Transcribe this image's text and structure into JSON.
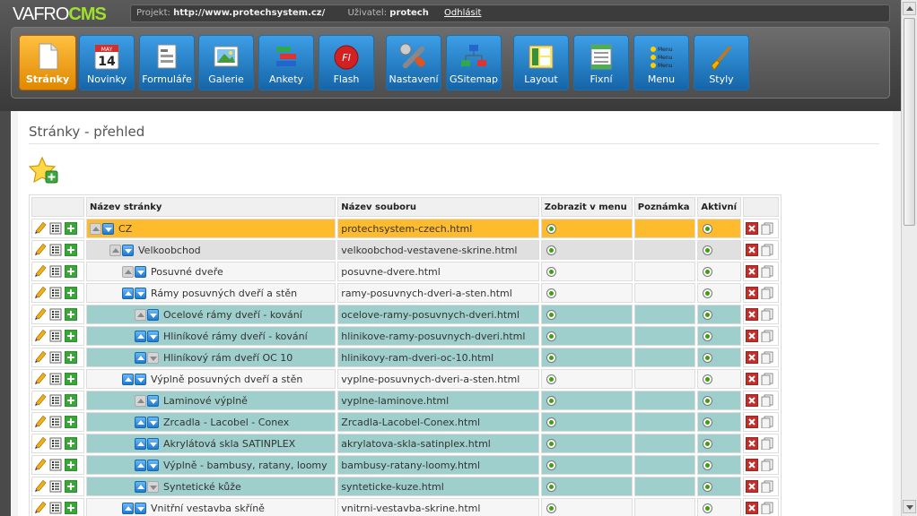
{
  "logo": {
    "part1": "VAFRO",
    "part2": "CMS"
  },
  "infobar": {
    "project_label": "Projekt:",
    "project_value": "http://www.protechsystem.cz/",
    "user_label": "Uživatel:",
    "user_value": "protech",
    "logout": "Odhlásit"
  },
  "toolbar": {
    "items": [
      {
        "label": "Stránky",
        "icon": "page-icon",
        "active": true
      },
      {
        "label": "Novinky",
        "icon": "calendar-icon",
        "calendar_month": "MAY",
        "calendar_day": "14"
      },
      {
        "label": "Formuláře",
        "icon": "form-icon"
      },
      {
        "label": "Galerie",
        "icon": "gallery-icon"
      },
      {
        "label": "Ankety",
        "icon": "poll-icon"
      },
      {
        "label": "Flash",
        "icon": "flash-icon",
        "icon_text": "Fl"
      },
      {
        "label": "Nastavení",
        "icon": "wrench-icon"
      },
      {
        "label": "GSitemap",
        "icon": "sitemap-icon"
      },
      {
        "label": "Layout",
        "icon": "layout-icon"
      },
      {
        "label": "Fixní",
        "icon": "fixed-icon"
      },
      {
        "label": "Menu",
        "icon": "menu-icon",
        "icon_text": "Menu"
      },
      {
        "label": "Styly",
        "icon": "brush-icon"
      }
    ]
  },
  "page": {
    "title": "Stránky - přehled"
  },
  "table": {
    "headers": {
      "name": "Název stránky",
      "file": "Název souboru",
      "show_in_menu": "Zobrazit v menu",
      "note": "Poznámka",
      "active": "Aktivní"
    },
    "rows": [
      {
        "name": "CZ",
        "file": "protechsystem-czech.html",
        "level": 0,
        "up": false,
        "down": true,
        "menu": true,
        "active": true
      },
      {
        "name": "Velkoobchod",
        "file": "velkoobchod-vestavene-skrine.html",
        "level": 1,
        "up": false,
        "down": true,
        "menu": true,
        "active": true
      },
      {
        "name": "Posuvné dveře",
        "file": "posuvne-dvere.html",
        "level": 2,
        "up": false,
        "down": true,
        "menu": true,
        "active": true
      },
      {
        "name": "Rámy posuvných dveří a stěn",
        "file": "ramy-posuvnych-dveri-a-sten.html",
        "level": 2,
        "up": true,
        "down": true,
        "menu": true,
        "active": true
      },
      {
        "name": "Ocelové rámy dveří - kování",
        "file": "ocelove-ramy-posuvnych-dveri.html",
        "level": 3,
        "up": false,
        "down": true,
        "menu": true,
        "active": true
      },
      {
        "name": "Hliníkové rámy dveří - kování",
        "file": "hlinikove-ramy-posuvnych-dveri.html",
        "level": 3,
        "up": true,
        "down": true,
        "menu": true,
        "active": true
      },
      {
        "name": "Hliníkový rám dveří OC 10",
        "file": "hlinikovy-ram-dveri-oc-10.html",
        "level": 3,
        "up": true,
        "down": false,
        "menu": true,
        "active": true
      },
      {
        "name": "Výplně posuvných dveří a stěn",
        "file": "vyplne-posuvnych-dveri-a-sten.html",
        "level": 2,
        "up": true,
        "down": true,
        "menu": true,
        "active": true
      },
      {
        "name": "Laminové výplně",
        "file": "vyplne-laminove.html",
        "level": 3,
        "up": false,
        "down": true,
        "menu": true,
        "active": true
      },
      {
        "name": "Zrcadla - Lacobel - Conex",
        "file": "Zrcadla-Lacobel-Conex.html",
        "level": 3,
        "up": true,
        "down": true,
        "menu": true,
        "active": true
      },
      {
        "name": "Akrylátová skla SATINPLEX",
        "file": "akrylatova-skla-satinplex.html",
        "level": 3,
        "up": true,
        "down": true,
        "menu": true,
        "active": true
      },
      {
        "name": "Výplně - bambusy, ratany, loomy",
        "file": "bambusy-ratany-loomy.html",
        "level": 3,
        "up": true,
        "down": true,
        "menu": true,
        "active": true
      },
      {
        "name": "Syntetické kůže",
        "file": "synteticke-kuze.html",
        "level": 3,
        "up": true,
        "down": false,
        "menu": true,
        "active": true
      },
      {
        "name": "Vnitřní vestavba skříně",
        "file": "vnitrni-vestavba-skrine.html",
        "level": 2,
        "up": true,
        "down": true,
        "menu": true,
        "active": true
      }
    ]
  }
}
